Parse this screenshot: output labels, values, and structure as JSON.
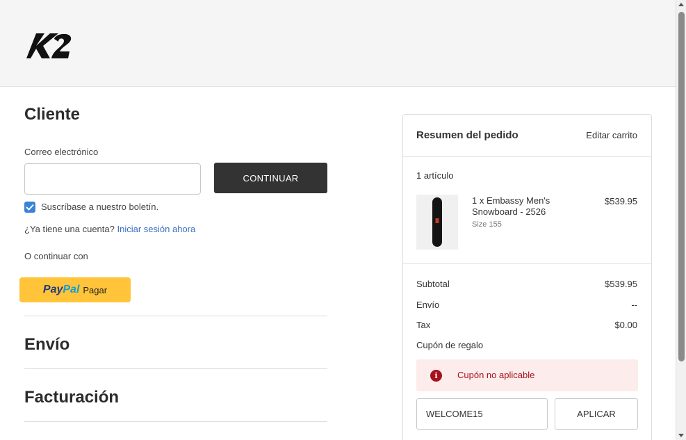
{
  "brand": {
    "logo_text": "K2"
  },
  "customer": {
    "title": "Cliente",
    "email_label": "Correo electrónico",
    "email_value": "",
    "continue_label": "CONTINUAR",
    "newsletter_label": "Suscríbase a nuestro boletín.",
    "newsletter_checked": true,
    "account_question": "¿Ya tiene una cuenta?",
    "login_link": "Iniciar sesión ahora",
    "or_continue": "O continuar con",
    "paypal": {
      "pay": "Pay",
      "pal": "Pal",
      "action": "Pagar"
    }
  },
  "shipping": {
    "title": "Envío"
  },
  "billing": {
    "title": "Facturación"
  },
  "summary": {
    "title": "Resumen del pedido",
    "edit_cart": "Editar carrito",
    "item_count": "1 artículo",
    "items": [
      {
        "name_line1": "1 x Embassy Men's",
        "name_line2": "Snowboard - 2526",
        "size": "Size 155",
        "price": "$539.95"
      }
    ],
    "rows": [
      {
        "label": "Subtotal",
        "value": "$539.95"
      },
      {
        "label": "Envío",
        "value": "--"
      },
      {
        "label": "Tax",
        "value": "$0.00"
      }
    ],
    "gift_coupon": "Cupón de regalo",
    "alert_text": "Cupón no aplicable",
    "coupon_value": "WELCOME15",
    "apply_label": "APLICAR"
  },
  "colors": {
    "accent_link": "#3a6fc4",
    "button_dark": "#333333",
    "paypal_yellow": "#ffc439",
    "error_red": "#a5121b",
    "error_bg": "#fdecec"
  }
}
